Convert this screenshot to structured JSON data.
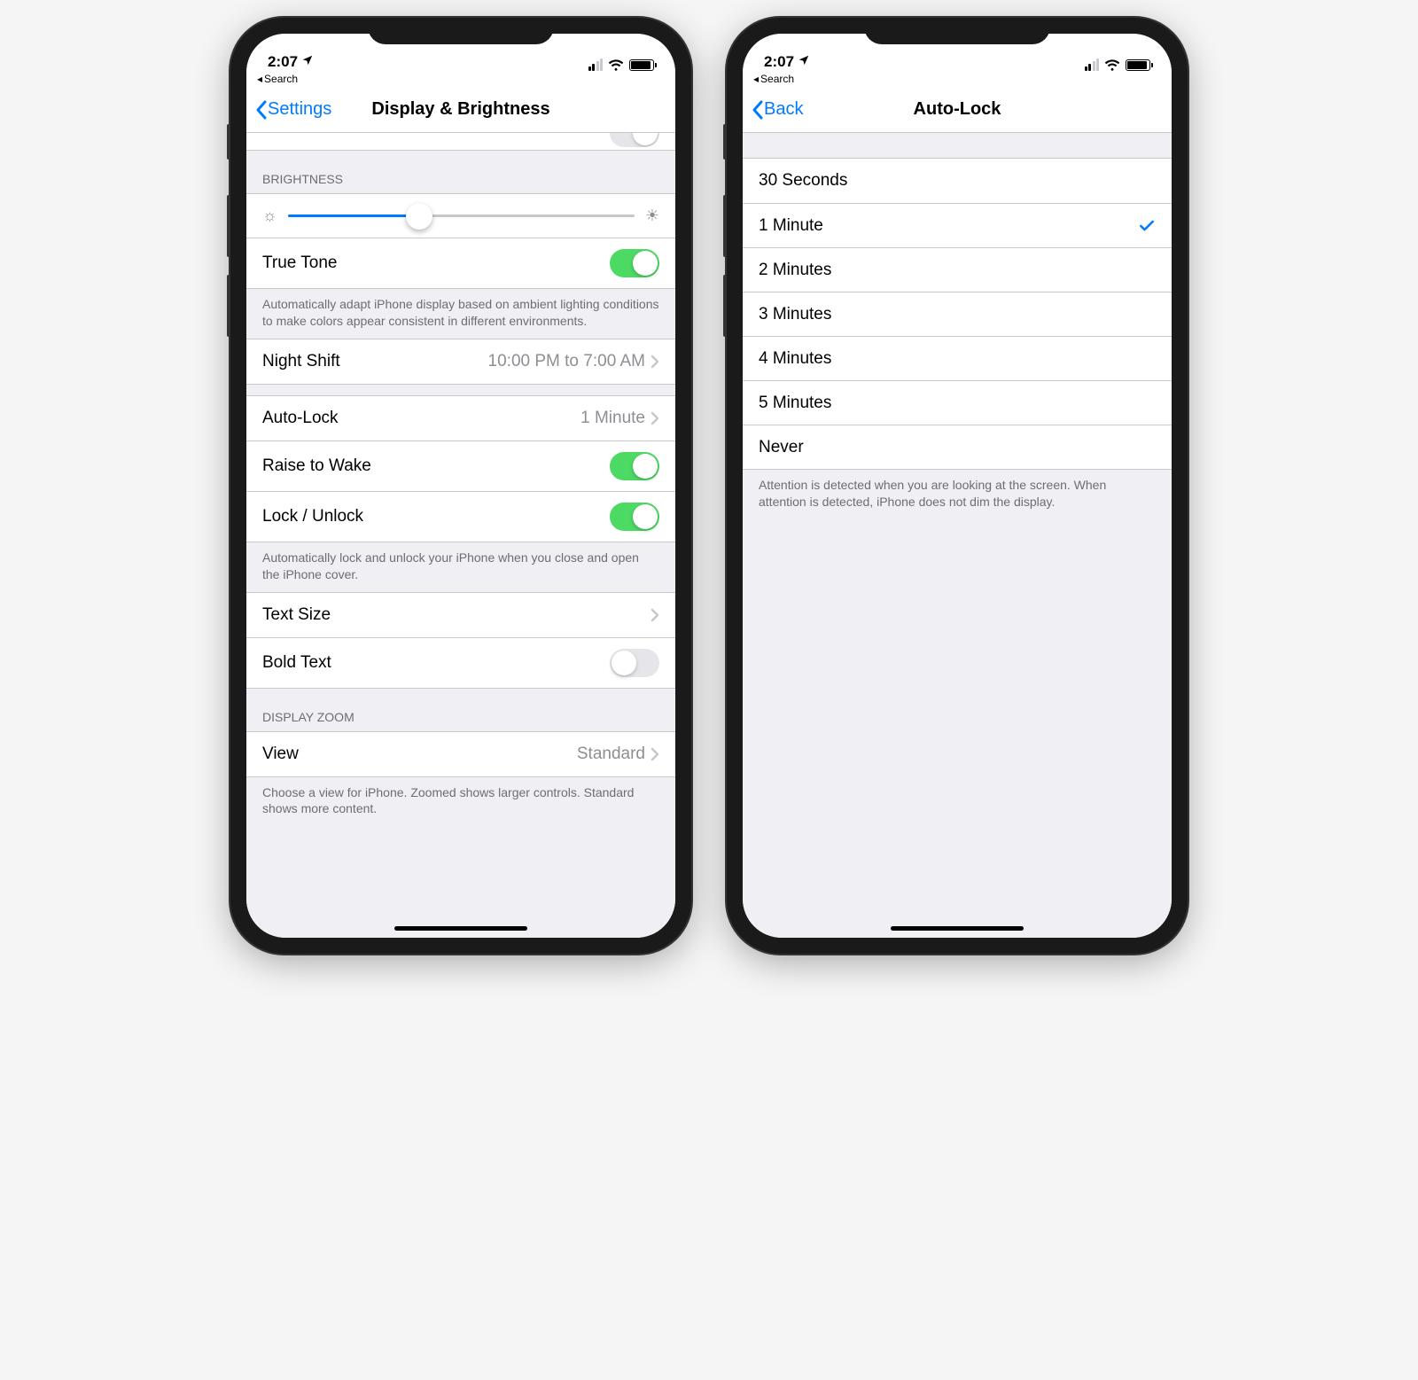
{
  "status": {
    "time": "2:07",
    "breadcrumb": "Search"
  },
  "left": {
    "nav_back": "Settings",
    "nav_title": "Display & Brightness",
    "brightness": {
      "header": "BRIGHTNESS",
      "slider_pct": 38
    },
    "truetone": {
      "label": "True Tone",
      "on": true,
      "footer": "Automatically adapt iPhone display based on ambient lighting conditions to make colors appear consistent in different environments."
    },
    "nightshift": {
      "label": "Night Shift",
      "detail": "10:00 PM to 7:00 AM"
    },
    "autolock": {
      "label": "Auto-Lock",
      "detail": "1 Minute"
    },
    "raise": {
      "label": "Raise to Wake",
      "on": true
    },
    "lockunlock": {
      "label": "Lock / Unlock",
      "on": true,
      "footer": "Automatically lock and unlock your iPhone when you close and open the iPhone cover."
    },
    "textsize": {
      "label": "Text Size"
    },
    "boldtext": {
      "label": "Bold Text",
      "on": false
    },
    "zoom": {
      "header": "DISPLAY ZOOM",
      "label": "View",
      "detail": "Standard",
      "footer": "Choose a view for iPhone. Zoomed shows larger controls. Standard shows more content."
    }
  },
  "right": {
    "nav_back": "Back",
    "nav_title": "Auto-Lock",
    "options": [
      {
        "label": "30 Seconds",
        "selected": false
      },
      {
        "label": "1 Minute",
        "selected": true
      },
      {
        "label": "2 Minutes",
        "selected": false
      },
      {
        "label": "3 Minutes",
        "selected": false
      },
      {
        "label": "4 Minutes",
        "selected": false
      },
      {
        "label": "5 Minutes",
        "selected": false
      },
      {
        "label": "Never",
        "selected": false
      }
    ],
    "footer": "Attention is detected when you are looking at the screen. When attention is detected, iPhone does not dim the display."
  }
}
